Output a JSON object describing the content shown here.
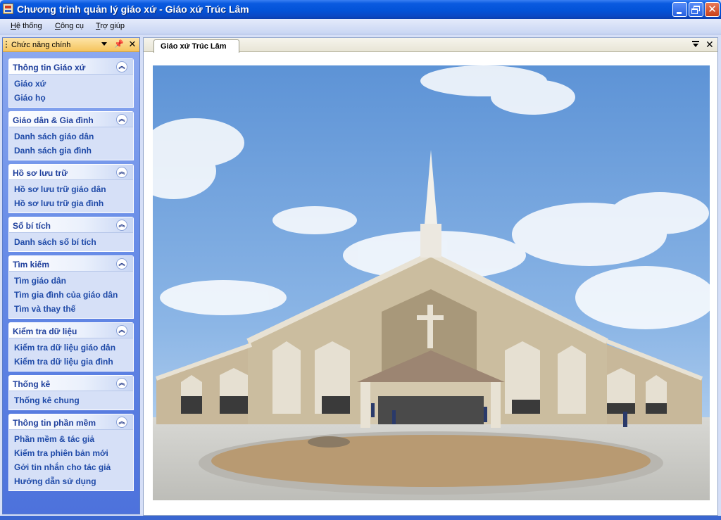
{
  "window": {
    "title": "Chương trình quản lý giáo xứ - Giáo xứ Trúc Lâm"
  },
  "menubar": {
    "items": [
      {
        "mnemonic": "H",
        "rest": "ệ thống"
      },
      {
        "mnemonic": "C",
        "rest": "ông cụ"
      },
      {
        "mnemonic": "T",
        "rest": "rợ giúp"
      }
    ]
  },
  "panel": {
    "title": "Chức năng chính",
    "groups": [
      {
        "title": "Thông tin Giáo xứ",
        "links": [
          "Giáo xứ",
          "Giáo họ"
        ]
      },
      {
        "title": "Giáo dân & Gia đình",
        "links": [
          "Danh sách giáo dân",
          "Danh sách gia đình"
        ]
      },
      {
        "title": "Hồ sơ lưu trữ",
        "links": [
          "Hồ sơ lưu trữ giáo dân",
          "Hồ sơ lưu trữ gia đình"
        ]
      },
      {
        "title": "Sổ bí tích",
        "links": [
          "Danh sách sổ bí tích"
        ]
      },
      {
        "title": "Tìm kiếm",
        "links": [
          "Tìm giáo dân",
          "Tìm gia đình của giáo dân",
          "Tìm và thay thế"
        ]
      },
      {
        "title": "Kiểm tra dữ liệu",
        "links": [
          "Kiểm tra dữ liệu giáo dân",
          "Kiểm tra dữ liệu gia đình"
        ]
      },
      {
        "title": "Thống kê",
        "links": [
          "Thống kê chung"
        ]
      },
      {
        "title": "Thông tin phần mềm",
        "links": [
          "Phần mềm & tác giả",
          "Kiểm tra phiên bản mới",
          "Gởi tin nhắn cho tác giả",
          "Hướng dẫn sử dụng"
        ]
      }
    ]
  },
  "document": {
    "tab_label": "Giáo xứ Trúc Lâm"
  },
  "icons": {
    "app": "app-icon",
    "minimize": "minimize-icon",
    "maximize": "restore-icon",
    "close": "close-icon",
    "collapse": "chevron-up-double-icon",
    "pin": "pin-icon",
    "dropdown": "dropdown-arrow-icon"
  },
  "colors": {
    "titlebar": "#0353d8",
    "panel_header": "#f5c45c",
    "group_title": "#1e3f9c",
    "link": "#1f4aa8"
  }
}
